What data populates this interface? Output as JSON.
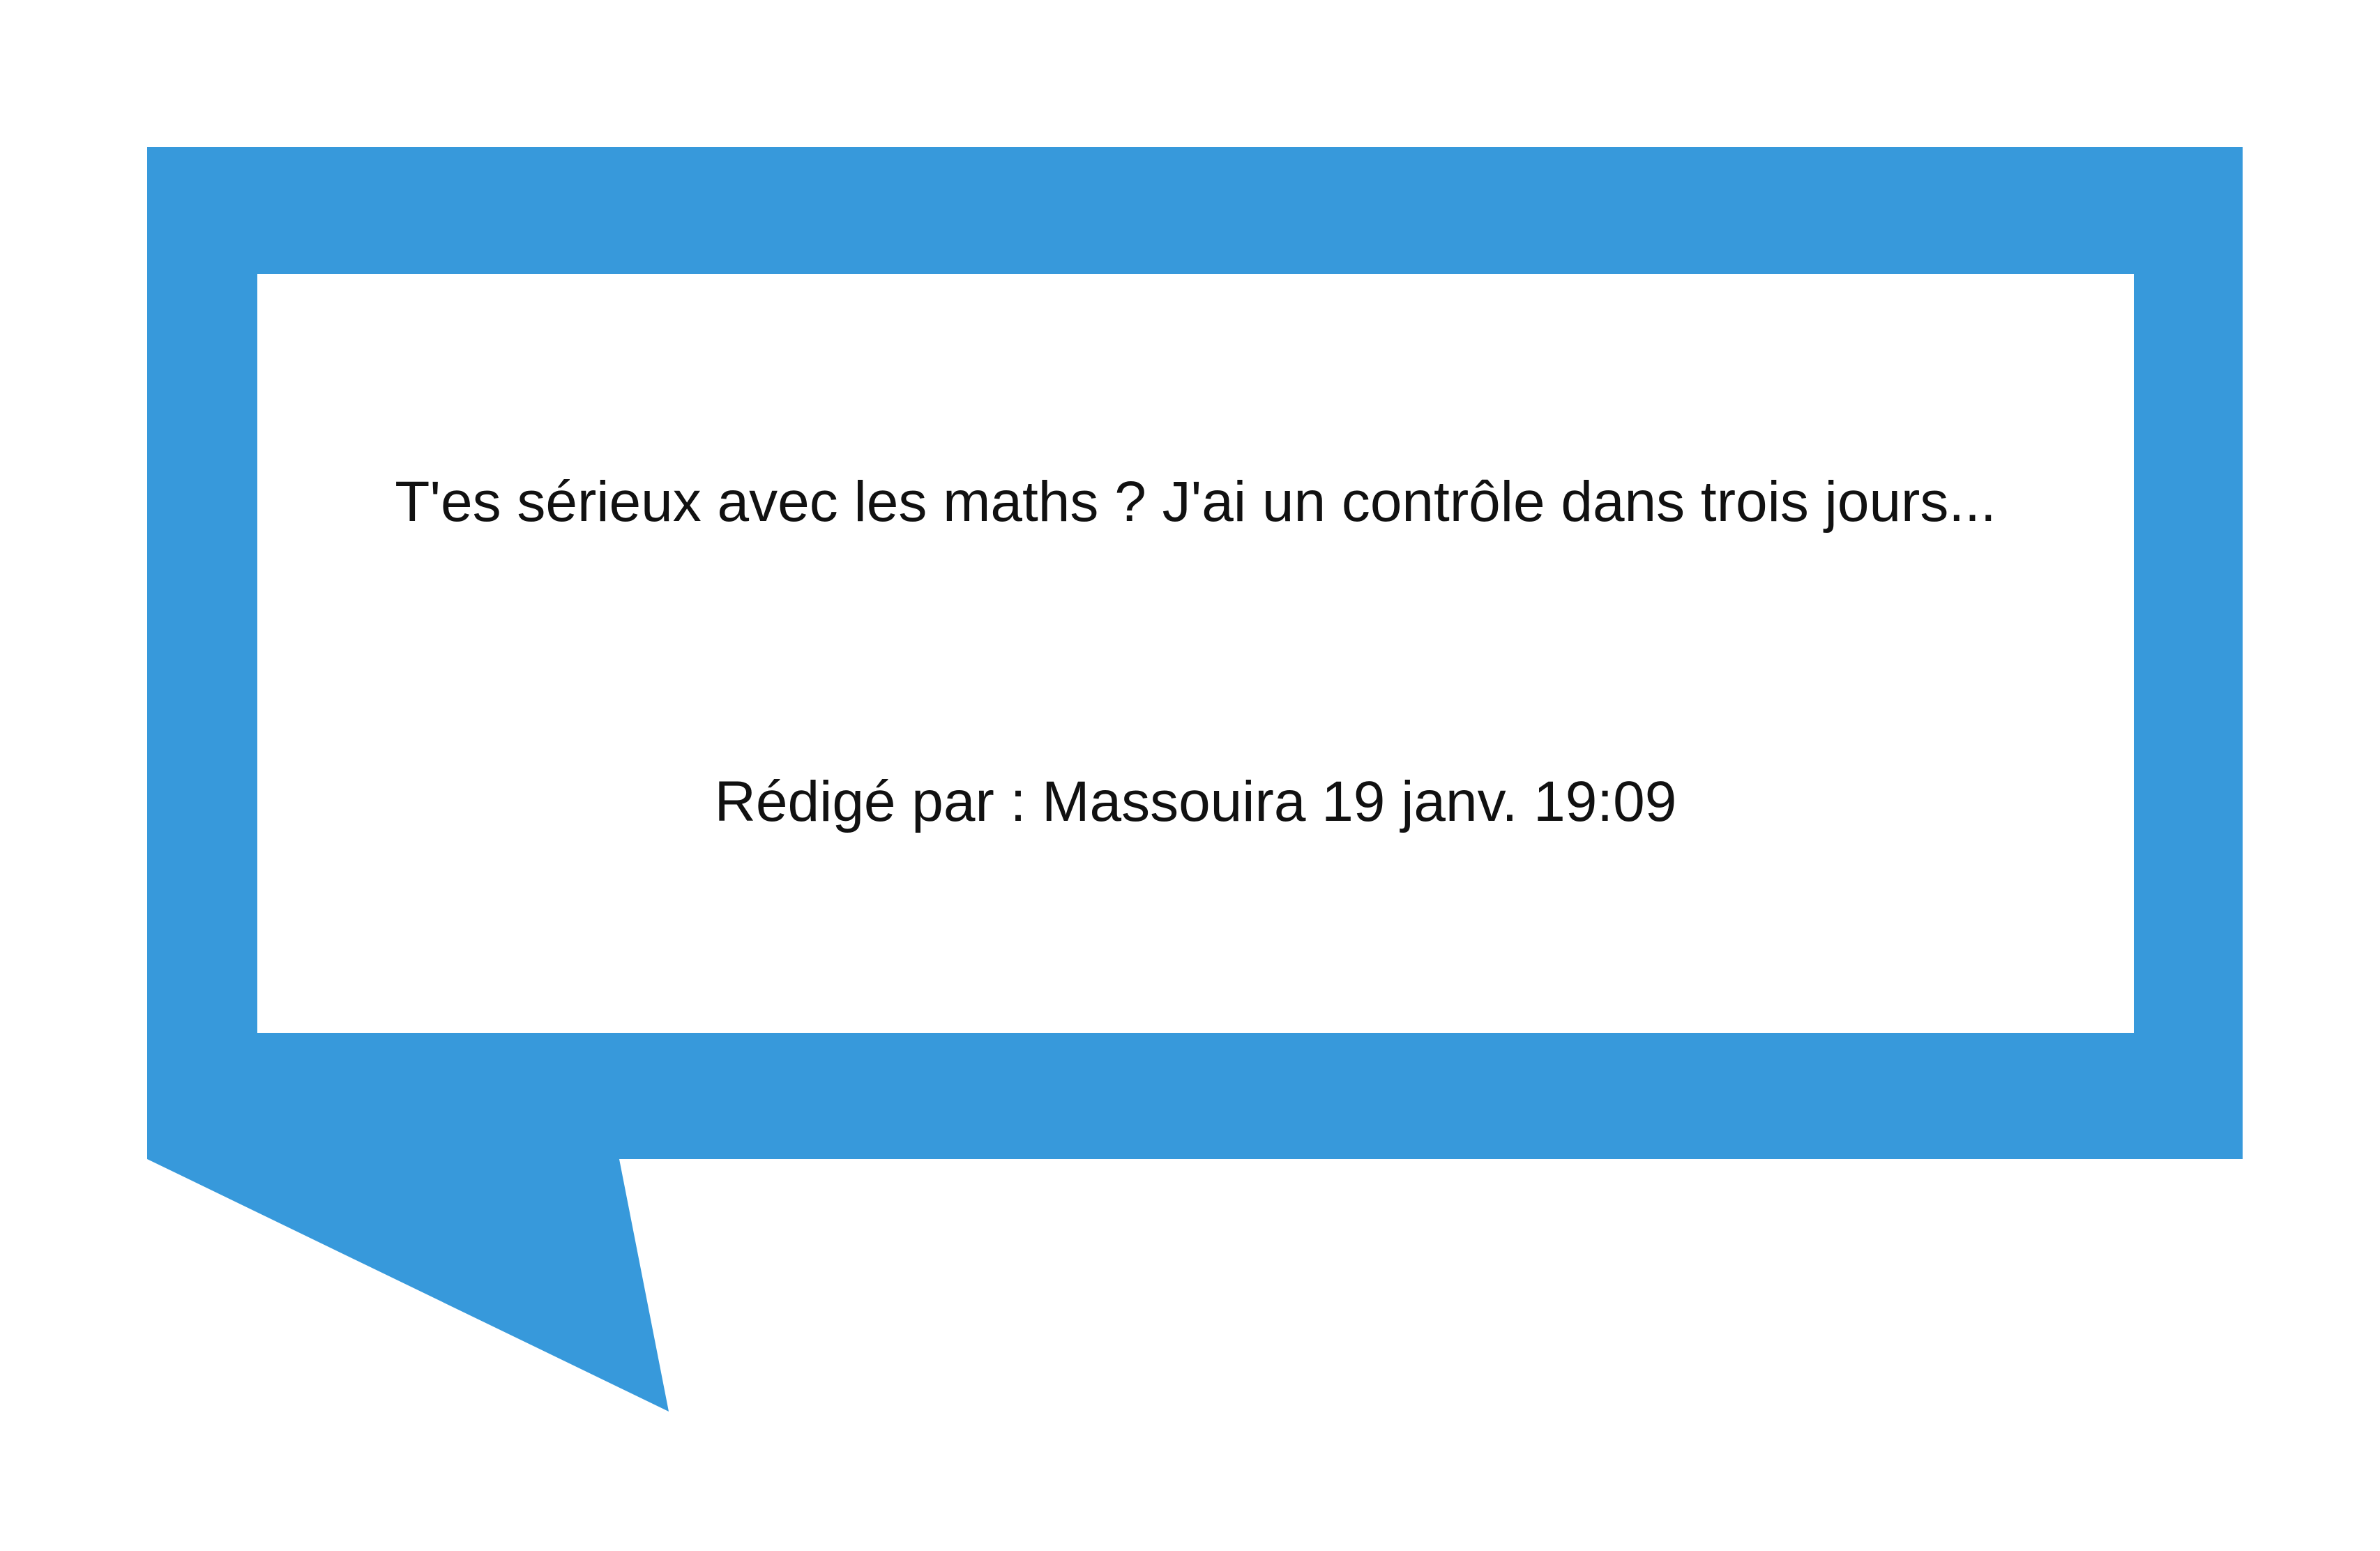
{
  "colors": {
    "bubble_border": "#3799db",
    "bubble_inner": "#ffffff",
    "text": "#111111",
    "background": "#ffffff"
  },
  "message": {
    "body": "T'es sérieux avec les maths ? J'ai un contrôle dans trois jours...",
    "meta": "Rédigé par : Massouira 19 janv. 19:09"
  }
}
